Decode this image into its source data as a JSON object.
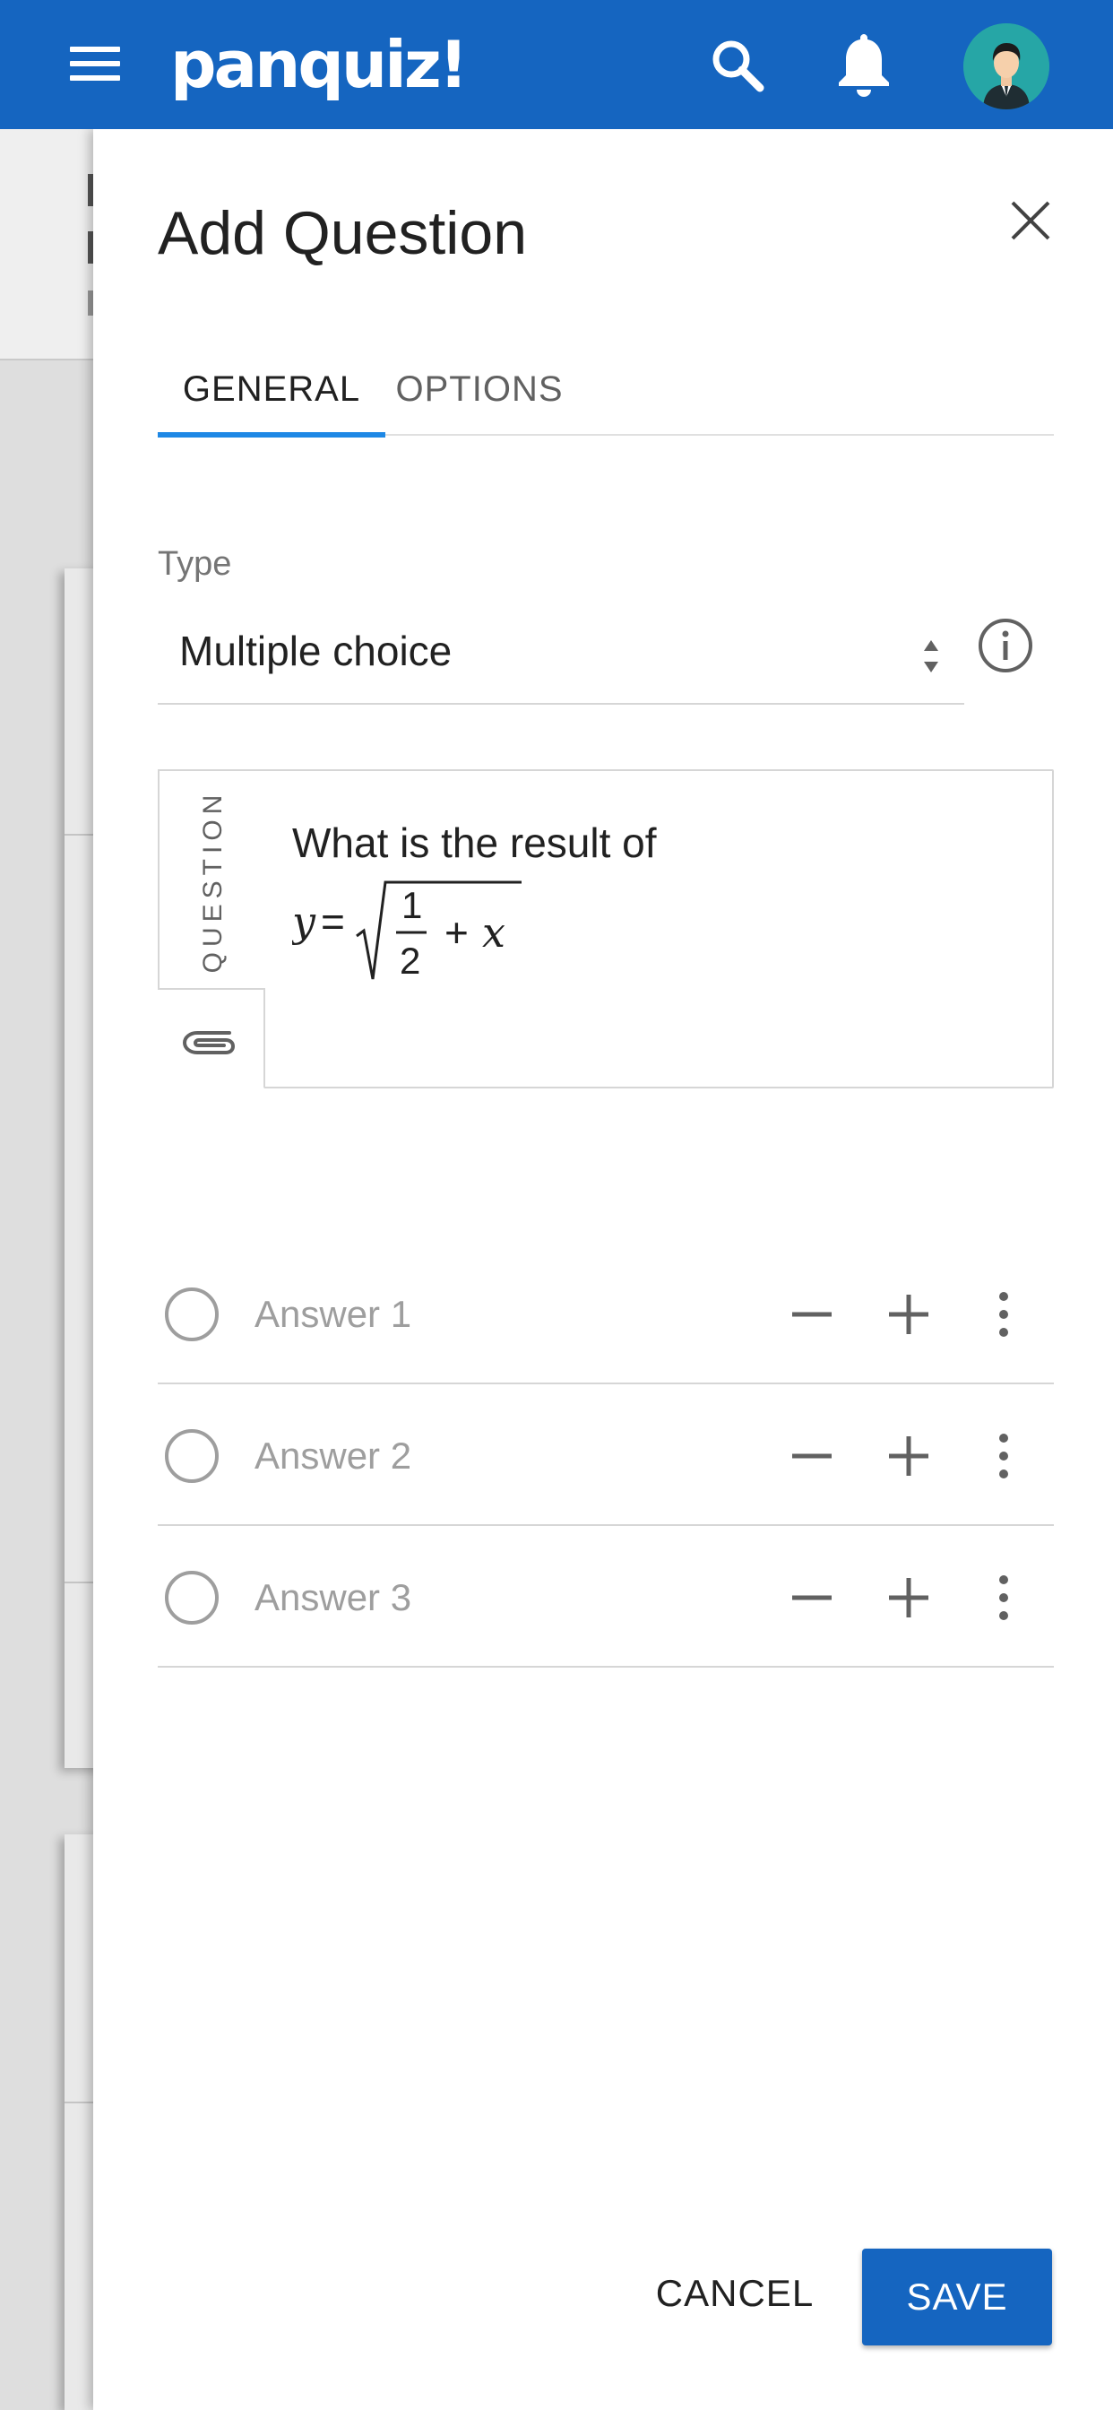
{
  "app": {
    "logo": "panquiz!",
    "brand_color": "#1565c0",
    "icons": [
      "menu-icon",
      "search-icon",
      "bell-icon",
      "avatar"
    ]
  },
  "dialog": {
    "title": "Add Question",
    "tabs": [
      {
        "label": "GENERAL",
        "active": true
      },
      {
        "label": "OPTIONS",
        "active": false
      }
    ],
    "type": {
      "label": "Type",
      "value": "Multiple choice"
    },
    "question": {
      "side_label": "QUESTION",
      "text": "What is the result of",
      "formula": {
        "lhs": "y",
        "equals": "=",
        "numerator": "1",
        "denominator": "2",
        "plus": "+",
        "var": "x"
      }
    },
    "answers": [
      {
        "placeholder": "Answer 1"
      },
      {
        "placeholder": "Answer 2"
      },
      {
        "placeholder": "Answer 3"
      }
    ],
    "actions": {
      "cancel": "CANCEL",
      "save": "SAVE"
    }
  }
}
